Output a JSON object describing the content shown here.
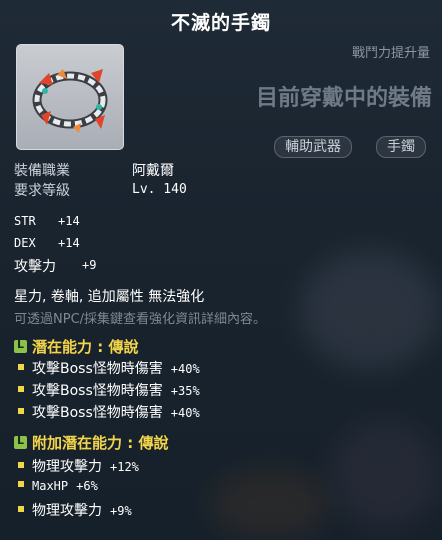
{
  "title": "不滅的手鐲",
  "power_label": "戰鬥力提升量",
  "equipped_text": "目前穿戴中的裝備",
  "tags": [
    "輔助武器",
    "手鐲"
  ],
  "job": {
    "label": "裝備職業",
    "value": "阿戴爾"
  },
  "level": {
    "label": "要求等級",
    "value": "Lv. 140"
  },
  "stats": [
    {
      "name": "STR",
      "value": "+14"
    },
    {
      "name": "DEX",
      "value": "+14"
    },
    {
      "name": "攻擊力",
      "value": "+9"
    }
  ],
  "enhance_line": "星力, 卷軸, 追加屬性 無法強化",
  "hint_line": "可透過NPC/採集鍵查看強化資訊詳細內容。",
  "potential": {
    "header": "潛在能力 : 傳說",
    "lines": [
      {
        "text": "攻擊Boss怪物時傷害",
        "value": "+40%"
      },
      {
        "text": "攻擊Boss怪物時傷害",
        "value": "+35%"
      },
      {
        "text": "攻擊Boss怪物時傷害",
        "value": "+40%"
      }
    ]
  },
  "additional": {
    "header": "附加潛在能力 : 傳說",
    "lines": [
      {
        "text": "物理攻擊力",
        "value": "+12%"
      },
      {
        "text": "MaxHP",
        "value": "+6%"
      },
      {
        "text": "物理攻擊力",
        "value": "+9%"
      }
    ]
  },
  "colors": {
    "title": "#ffffff",
    "section_header": "#f3d54a",
    "badge": "#8ac34a"
  },
  "icons": [
    "bracelet-item-icon",
    "legendary-badge-icon"
  ]
}
